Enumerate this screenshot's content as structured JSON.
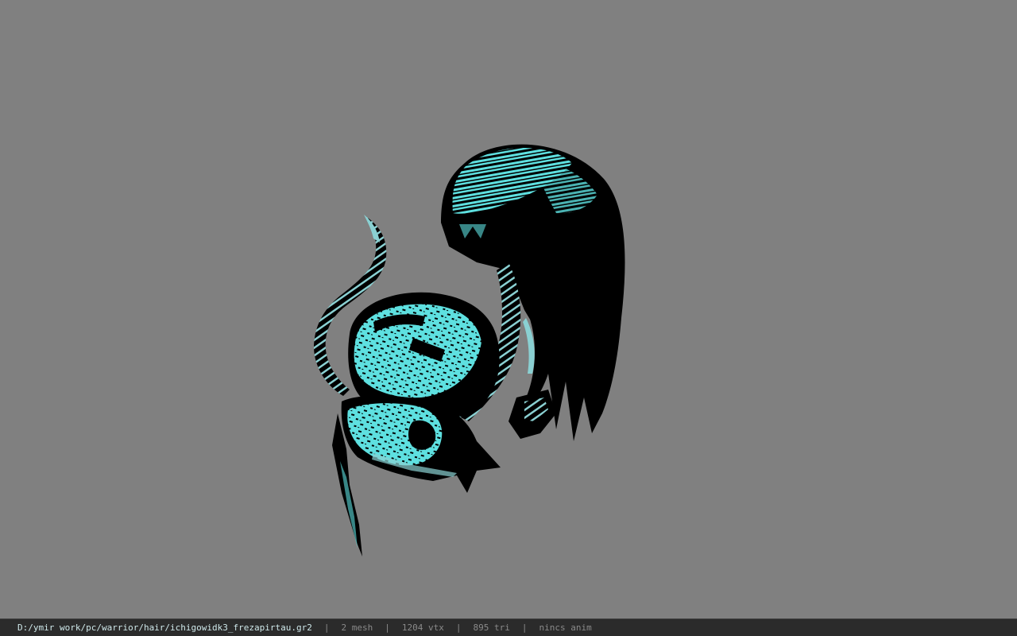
{
  "viewer": {
    "background_color": "#808080",
    "model_colors": {
      "shadow": "#000000",
      "highlight": "#5ee0e0"
    }
  },
  "statusbar": {
    "file_path": "D:/ymir work/pc/warrior/hair/ichigowidk3_frezapirtau.gr2",
    "separator": "|",
    "mesh_count": "2 mesh",
    "vertex_count": "1204 vtx",
    "triangle_count": "895 tri",
    "anim_status": "nincs anim"
  }
}
